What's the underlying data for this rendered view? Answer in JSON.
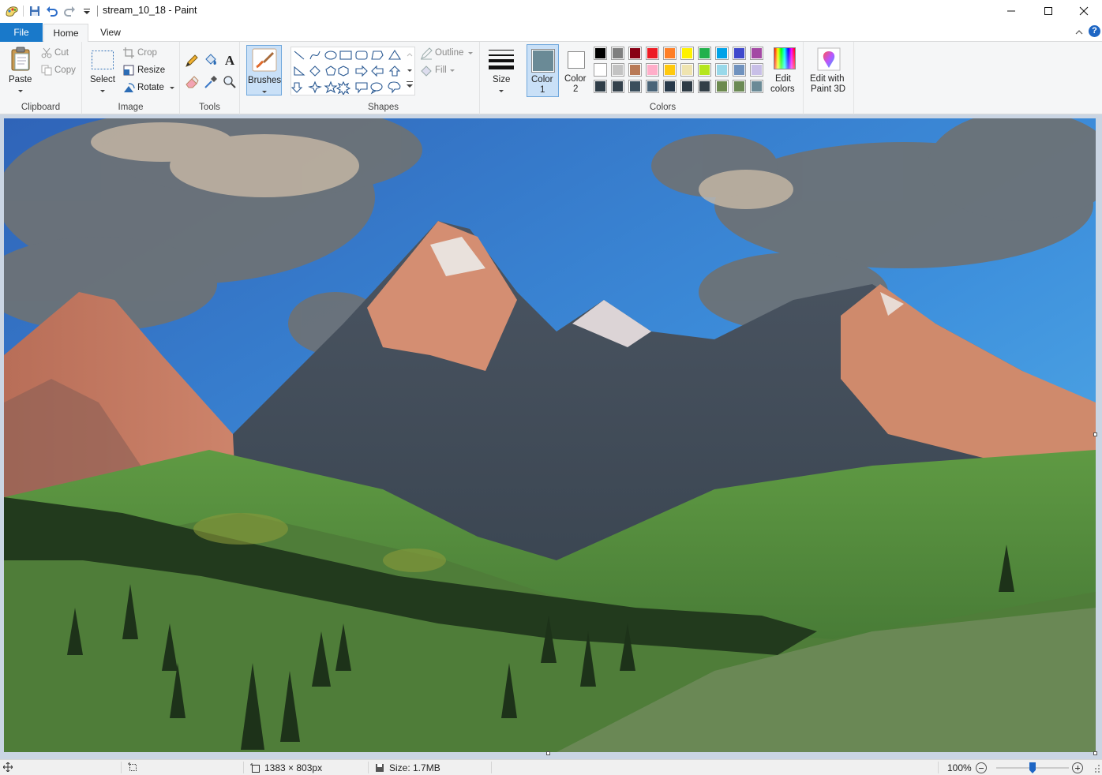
{
  "window": {
    "title": "stream_10_18 - Paint"
  },
  "tabs": {
    "file": "File",
    "home": "Home",
    "view": "View"
  },
  "clipboard": {
    "paste": "Paste",
    "cut": "Cut",
    "copy": "Copy",
    "group": "Clipboard"
  },
  "image": {
    "select": "Select",
    "crop": "Crop",
    "resize": "Resize",
    "rotate": "Rotate",
    "group": "Image"
  },
  "tools": {
    "group": "Tools"
  },
  "brushes": {
    "label": "Brushes"
  },
  "shapes": {
    "outline": "Outline",
    "fill": "Fill",
    "group": "Shapes"
  },
  "size": {
    "label": "Size"
  },
  "colors": {
    "color1_line1": "Color",
    "color1_line2": "1",
    "color2_line1": "Color",
    "color2_line2": "2",
    "color1_value": "#6a8a96",
    "color2_value": "#ffffff",
    "edit_line1": "Edit",
    "edit_line2": "colors",
    "group": "Colors",
    "palette_row1": [
      "#000000",
      "#7f7f7f",
      "#880015",
      "#ed1c24",
      "#ff7f27",
      "#fff200",
      "#22b14c",
      "#00a2e8",
      "#3f48cc",
      "#a349a4"
    ],
    "palette_row2": [
      "#ffffff",
      "#c3c3c3",
      "#b97a57",
      "#ffaec9",
      "#ffc90e",
      "#efe4b0",
      "#b5e61d",
      "#99d9ea",
      "#7092be",
      "#c8bfe7"
    ],
    "palette_row3": [
      "#2f3d47",
      "#34414b",
      "#3b4f5c",
      "#4a6478",
      "#27394a",
      "#2e3b45",
      "#333f47",
      "#6c8a4f",
      "#6b8a55",
      "#6a8a96"
    ]
  },
  "paint3d": {
    "line1": "Edit with",
    "line2": "Paint 3D"
  },
  "status": {
    "dimensions": "1383 × 803px",
    "size": "Size: 1.7MB",
    "zoom": "100%",
    "zoom_level": 0.5
  }
}
